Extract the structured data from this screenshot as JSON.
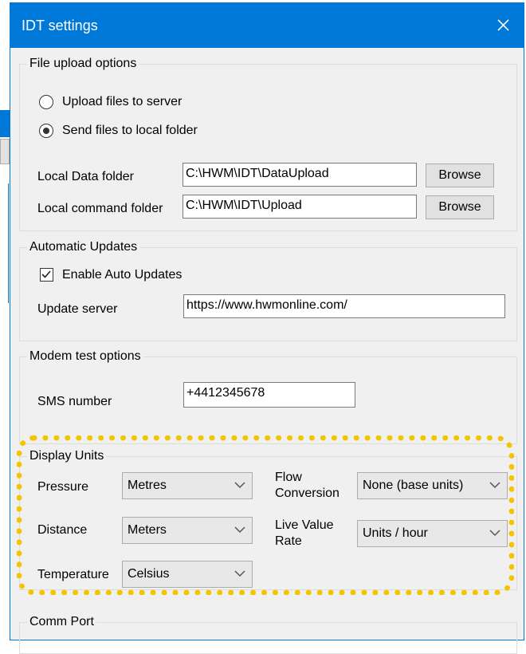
{
  "window": {
    "title": "IDT settings",
    "close_icon": "close-icon"
  },
  "file_upload": {
    "legend": "File upload options",
    "radio_upload_server": "Upload files to server",
    "radio_local_folder": "Send files to local folder",
    "selected": "local_folder",
    "local_data_label": "Local Data folder",
    "local_data_value": "C:\\HWM\\IDT\\DataUpload",
    "local_command_label": "Local command folder",
    "local_command_value": "C:\\HWM\\IDT\\Upload",
    "browse_label": "Browse"
  },
  "auto_updates": {
    "legend": "Automatic Updates",
    "enable_label": "Enable Auto Updates",
    "enabled": true,
    "server_label": "Update server",
    "server_value": "https://www.hwmonline.com/"
  },
  "modem": {
    "legend": "Modem test options",
    "sms_label": "SMS number",
    "sms_value": "+4412345678"
  },
  "display_units": {
    "legend": "Display Units",
    "pressure_label": "Pressure",
    "pressure_value": "Metres",
    "distance_label": "Distance",
    "distance_value": "Meters",
    "temperature_label": "Temperature",
    "temperature_value": "Celsius",
    "flow_label_1": "Flow",
    "flow_label_2": "Conversion",
    "flow_value": "None (base units)",
    "live_label_1": "Live Value",
    "live_label_2": "Rate",
    "live_value": "Units / hour",
    "highlight_color": "#f5c400"
  },
  "comm_port": {
    "legend": "Comm Port"
  },
  "colors": {
    "accent": "#0078d7",
    "dialog_bg": "#f0f0f0"
  }
}
